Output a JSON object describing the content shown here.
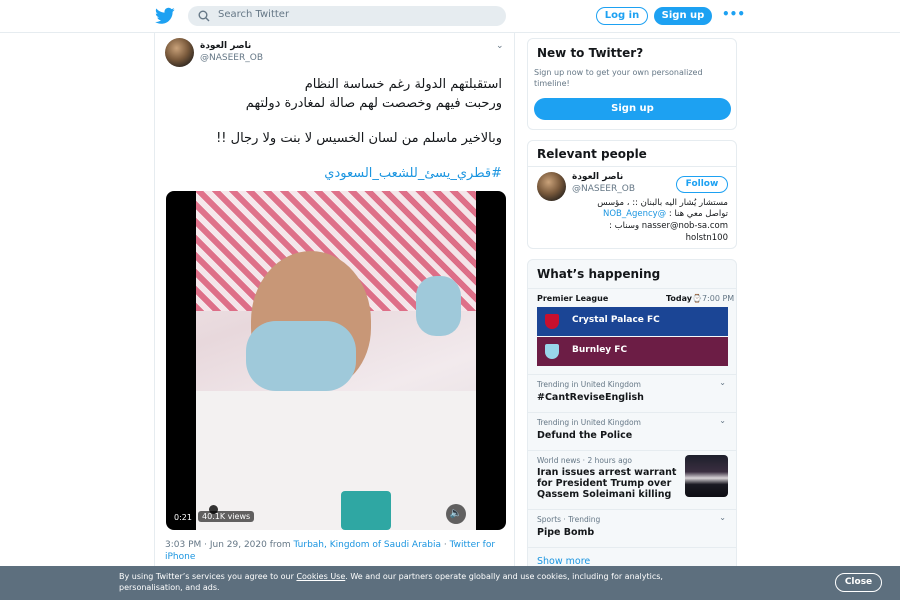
{
  "topbar": {
    "logo": "twitter-bird-icon",
    "search_placeholder": "Search Twitter",
    "login_label": "Log in",
    "signup_label": "Sign up",
    "more_label": "•••"
  },
  "tweet": {
    "author_name": "ناصر العودة",
    "author_handle": "@NASEER_OB",
    "text_lines": [
      "استقبلتهم الدولة رغم خساسة النظام",
      "ورحبت فيهم وخصصت لهم صالة لمغادرة دولتهم",
      "وبالاخير ماسلم من لسان الخسيس لا بنت ولا رجال !!"
    ],
    "hashtag": "#قطري_يسئ_للشعب_السعودي",
    "video": {
      "time": "0:21",
      "views": "40.1K views"
    },
    "meta_time": "3:03 PM · Jun 29, 2020 from",
    "meta_location": "Turbah, Kingdom of Saudi Arabia",
    "meta_sep": "·",
    "meta_source": "Twitter for iPhone"
  },
  "new_to_twitter": {
    "title": "New to Twitter?",
    "subtitle": "Sign up now to get your own personalized timeline!",
    "signup_label": "Sign up"
  },
  "relevant_people": {
    "title": "Relevant people",
    "name": "ناصر العودة",
    "handle": "@NASEER_OB",
    "follow_label": "Follow",
    "bio_line1": "مستشار يُشار اليه بالبنان :: ، مؤسس",
    "bio_link": "@NOB_Agency",
    "bio_line2_rest": "تواصل معي هنا :",
    "bio_line3": "nasser@nob-sa.com وسناب :",
    "bio_line4": "holstn100"
  },
  "whats_happening": {
    "title": "What’s happening",
    "league": "Premier League",
    "time_bold": "Today",
    "time_rest": "⌚7:00 PM",
    "teams": [
      {
        "name": "Crystal Palace FC",
        "color": "#1b4595",
        "crest_color": "#c8102e"
      },
      {
        "name": "Burnley FC",
        "color": "#6c1d45",
        "crest_color": "#99d6ea"
      }
    ],
    "trends": [
      {
        "context": "Trending in United Kingdom",
        "title": "#CantReviseEnglish"
      },
      {
        "context": "Trending in United Kingdom",
        "title": "Defund the Police"
      },
      {
        "context": "World news · 2 hours ago",
        "title": "Iran issues arrest warrant for President Trump over Qassem Soleimani killing"
      },
      {
        "context": "Sports · Trending",
        "title": "Pipe Bomb"
      }
    ],
    "show_more": "Show more"
  },
  "cookie": {
    "text_before": "By using Twitter’s services you agree to our",
    "link": "Cookies Use",
    "text_after": ". We and our partners operate globally and use cookies, including for analytics, personalisation, and ads.",
    "close_label": "Close"
  },
  "colors": {
    "accent": "#1da1f2",
    "link": "#1b95e0",
    "banner": "#5d6f7e"
  }
}
